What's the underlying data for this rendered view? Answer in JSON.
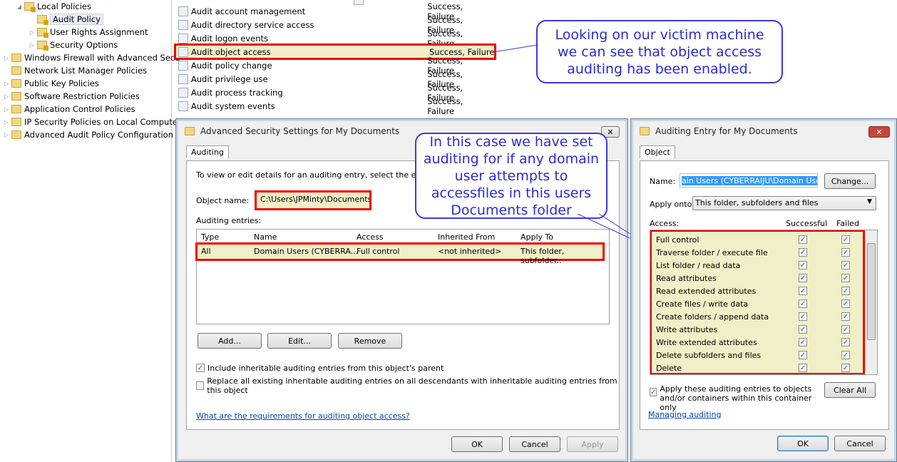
{
  "tree": {
    "items": [
      {
        "label": "Local Policies",
        "expanded": true
      },
      {
        "label": "Audit Policy",
        "selected": true
      },
      {
        "label": "User Rights Assignment"
      },
      {
        "label": "Security Options"
      },
      {
        "label": "Windows Firewall with Advanced Secu"
      },
      {
        "label": "Network List Manager Policies"
      },
      {
        "label": "Public Key Policies"
      },
      {
        "label": "Software Restriction Policies"
      },
      {
        "label": "Application Control Policies"
      },
      {
        "label": "IP Security Policies on Local Compute"
      },
      {
        "label": "Advanced Audit Policy Configuration"
      }
    ]
  },
  "policies": [
    {
      "name": "Audit account management",
      "setting": "Success, Failure"
    },
    {
      "name": "Audit directory service access",
      "setting": "Success, Failure"
    },
    {
      "name": "Audit logon events",
      "setting": "Success, Failure"
    },
    {
      "name": "Audit object access",
      "setting": "Success, Failure"
    },
    {
      "name": "Audit policy change",
      "setting": "Success, Failure"
    },
    {
      "name": "Audit privilege use",
      "setting": "Success, Failure"
    },
    {
      "name": "Audit process tracking",
      "setting": "Success, Failure"
    },
    {
      "name": "Audit system events",
      "setting": "Success, Failure"
    }
  ],
  "callouts": {
    "victim": "Looking on our victim machine we can see that object access auditing has been enabled.",
    "case": "In this case we have set auditing for if any domain user attempts to accessfiles in this users Documents folder"
  },
  "adv": {
    "title": "Advanced Security Settings for My Documents",
    "tab": "Auditing",
    "instructions": "To view or edit details for an auditing entry, select the entry and",
    "object_label": "Object name:",
    "object_value": "C:\\Users\\JPMinty\\Documents",
    "entries_label": "Auditing entries:",
    "columns": [
      "Type",
      "Name",
      "Access",
      "Inherited From",
      "Apply To"
    ],
    "rows": [
      [
        "All",
        "Domain Users (CYBERRA...",
        "Full control",
        "<not inherited>",
        "This folder, subfolder.."
      ]
    ],
    "add": "Add...",
    "edit": "Edit...",
    "remove": "Remove",
    "include": "Include inheritable auditing entries from this object's parent",
    "replace": "Replace all existing inheritable auditing entries on all descendants with inheritable auditing entries from this object",
    "include_checked": true,
    "replace_checked": false,
    "link": "What are the requirements for auditing object access?",
    "ok": "OK",
    "cancel": "Cancel",
    "apply": "Apply"
  },
  "entry": {
    "title": "Auditing Entry for My Documents",
    "tab": "Object",
    "name_label": "Name:",
    "name_value": "ain Users (CYBERRAIJU\\Domain Users)",
    "change": "Change...",
    "apply_label": "Apply onto:",
    "apply_value": "This folder, subfolders and files",
    "access_label": "Access:",
    "successful": "Successful",
    "failed": "Failed",
    "permissions": [
      "Full control",
      "Traverse folder / execute file",
      "List folder / read data",
      "Read attributes",
      "Read extended attributes",
      "Create files / write data",
      "Create folders / append data",
      "Write attributes",
      "Write extended attributes",
      "Delete subfolders and files",
      "Delete"
    ],
    "apply_check": "Apply these auditing entries to objects and/or containers within this container only",
    "apply_checked": true,
    "clear": "Clear All",
    "link": "Managing auditing",
    "ok": "OK",
    "cancel": "Cancel"
  },
  "colors": {
    "highlight": "#e00000",
    "callout": "#2b2bd8",
    "selected_row": "#f0efc8"
  }
}
